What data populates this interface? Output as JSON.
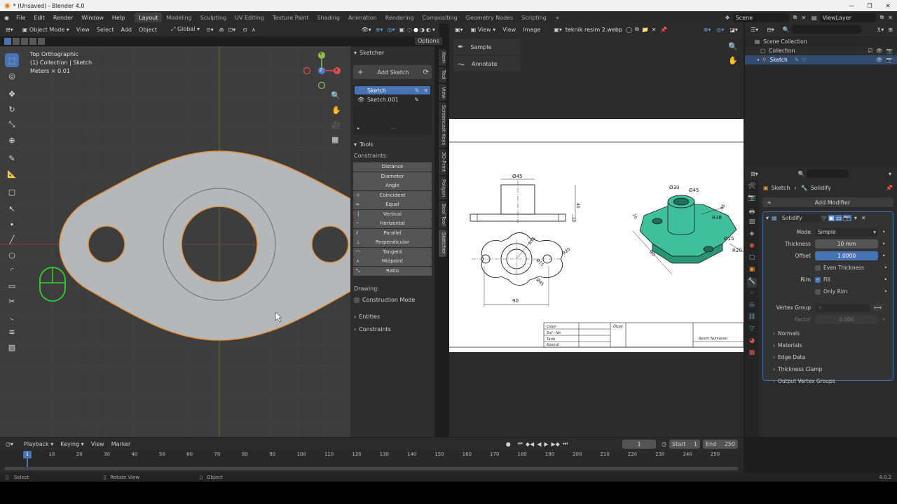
{
  "window": {
    "title": "* (Unsaved) - Blender 4.0",
    "min": "—",
    "max": "❐",
    "close": "✕"
  },
  "menu": [
    "File",
    "Edit",
    "Render",
    "Window",
    "Help"
  ],
  "workspaces": [
    "Layout",
    "Modeling",
    "Sculpting",
    "UV Editing",
    "Texture Paint",
    "Shading",
    "Animation",
    "Rendering",
    "Compositing",
    "Geometry Nodes",
    "Scripting"
  ],
  "active_workspace": "Layout",
  "scene": {
    "name": "Scene",
    "view_layer": "ViewLayer"
  },
  "viewport": {
    "mode": "Object Mode",
    "menus": [
      "View",
      "Select",
      "Add",
      "Object"
    ],
    "transform": "Global",
    "options": "Options",
    "overlay": {
      "view": "Top Orthographic",
      "collection": "(1) Collection | Sketch",
      "scale": "Meters × 0.01"
    },
    "gizmo": {
      "x": "X",
      "y": "Y",
      "z": "Z"
    }
  },
  "sketcher": {
    "title": "Sketcher",
    "add_sketch": "Add Sketch",
    "sketches": [
      "Sketch",
      "Sketch.001"
    ],
    "tools_title": "Tools",
    "constraints_label": "Constraints:",
    "constraints": [
      "Distance",
      "Diameter",
      "Angle",
      "Coincident",
      "Equal",
      "Vertical",
      "Horizontal",
      "Parallel",
      "Perpendicular",
      "Tangent",
      "Midpoint",
      "Ratio"
    ],
    "drawing_label": "Drawing:",
    "construction_mode": "Construction Mode",
    "entities": "Entities",
    "constraints_section": "Constraints"
  },
  "side_tabs": [
    "Item",
    "Tool",
    "View",
    "Screencast Keys",
    "3D-Print",
    "Poligon",
    "Bool Tool",
    "Sketcher"
  ],
  "image_editor": {
    "menus": [
      "View",
      "View",
      "Image"
    ],
    "image_name": "teknik resim 2.webp",
    "tools": [
      "Sample",
      "Annotate"
    ],
    "drawing": {
      "dims": [
        "Ø45",
        "40",
        "10",
        "R38",
        "Ø15",
        "R20",
        "Ø45",
        "90",
        "Ø30",
        "Ø45",
        "R38",
        "40",
        "10",
        "Ø15",
        "R20",
        "90"
      ],
      "table": [
        "Çizen",
        "Snf - No",
        "Tarih",
        "Kontrol",
        "Ölçek",
        "Resim Numarası"
      ]
    }
  },
  "outliner": {
    "items": [
      "Scene Collection",
      "Collection",
      "Sketch"
    ]
  },
  "properties": {
    "breadcrumb": [
      "Sketch",
      "Solidify"
    ],
    "add_modifier": "Add Modifier",
    "modifier_name": "Solidify",
    "mode_label": "Mode",
    "mode_value": "Simple",
    "thickness_label": "Thickness",
    "thickness_value": "10 mm",
    "offset_label": "Offset",
    "offset_value": "1.0000",
    "even_thickness": "Even Thickness",
    "rim_label": "Rim",
    "fill": "Fill",
    "only_rim": "Only Rim",
    "vertex_group_label": "Vertex Group",
    "factor_label": "Factor",
    "factor_value": "0.000",
    "sections": [
      "Normals",
      "Materials",
      "Edge Data",
      "Thickness Clamp",
      "Output Vertex Groups"
    ]
  },
  "timeline": {
    "menus": [
      "Playback",
      "Keying",
      "View",
      "Marker"
    ],
    "current": "1",
    "start_label": "Start",
    "start": "1",
    "end_label": "End",
    "end": "250",
    "ticks": [
      "1",
      "10",
      "20",
      "30",
      "40",
      "50",
      "60",
      "70",
      "80",
      "90",
      "100",
      "110",
      "120",
      "130",
      "140",
      "150",
      "160",
      "170",
      "180",
      "190",
      "200",
      "210",
      "220",
      "230",
      "240",
      "250"
    ]
  },
  "statusbar": {
    "select": "Select",
    "rotate": "Rotate View",
    "object": "Object",
    "version": "4.0.2"
  },
  "colors": {
    "accent": "#4772b3",
    "viewport_bg": "#3d3d3d",
    "mesh": "#b4b8bb",
    "teal": "#3fbf9a"
  }
}
